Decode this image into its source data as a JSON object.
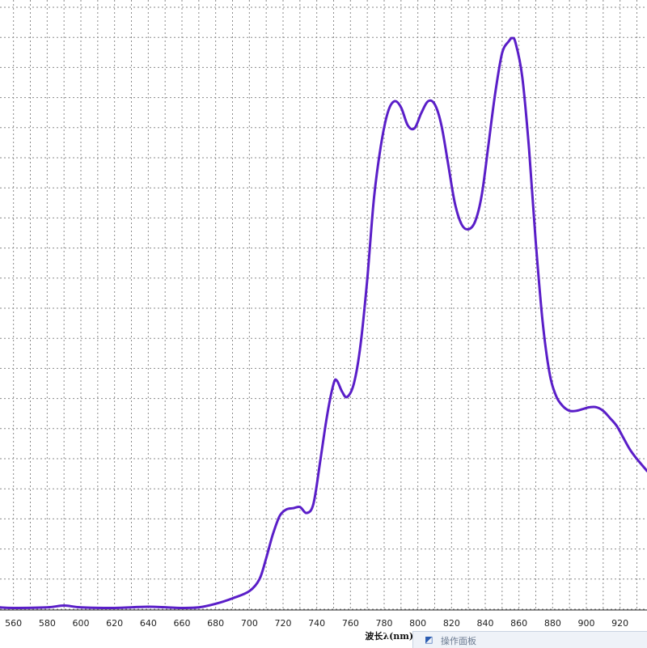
{
  "chart_data": {
    "type": "line",
    "title": "",
    "xlabel": "波长λ(nm)",
    "ylabel": "",
    "xlim": [
      552,
      936
    ],
    "ylim": [
      0,
      100
    ],
    "grid": true,
    "x_ticks": [
      560,
      580,
      600,
      620,
      640,
      660,
      680,
      700,
      720,
      740,
      760,
      780,
      800,
      820,
      840,
      860,
      880,
      900,
      920
    ],
    "series": [
      {
        "color": "#5a1ec8",
        "x": [
          552,
          560,
          580,
          590,
          600,
          620,
          640,
          660,
          670,
          680,
          690,
          700,
          706,
          710,
          714,
          718,
          722,
          726,
          730,
          734,
          738,
          742,
          746,
          750,
          752,
          755,
          758,
          762,
          766,
          770,
          774,
          778,
          782,
          786,
          790,
          794,
          798,
          802,
          806,
          810,
          814,
          818,
          822,
          826,
          830,
          834,
          838,
          842,
          846,
          850,
          854,
          856,
          858,
          862,
          866,
          870,
          874,
          878,
          882,
          886,
          890,
          894,
          898,
          902,
          906,
          910,
          914,
          918,
          922,
          926,
          930,
          936
        ],
        "y": [
          0.3,
          0.2,
          0.3,
          0.6,
          0.3,
          0.2,
          0.4,
          0.2,
          0.3,
          0.9,
          1.8,
          3.0,
          5.0,
          8.5,
          12.5,
          15.5,
          16.6,
          16.8,
          17.0,
          16.0,
          17.5,
          24.5,
          32.0,
          37.5,
          38.0,
          36.2,
          35.3,
          37.5,
          44.0,
          55.0,
          68.5,
          77.0,
          82.5,
          84.5,
          83.5,
          80.5,
          80.0,
          82.5,
          84.5,
          84.0,
          80.5,
          74.0,
          67.5,
          64.0,
          63.2,
          64.5,
          69.0,
          77.5,
          86.0,
          92.5,
          94.5,
          95.0,
          94.2,
          88.5,
          76.5,
          61.0,
          48.0,
          39.5,
          35.5,
          33.8,
          33.0,
          33.0,
          33.3,
          33.6,
          33.6,
          33.0,
          31.8,
          30.5,
          28.5,
          26.5,
          25.0,
          23.0
        ]
      }
    ]
  },
  "taskbar": {
    "icon": "app-icon",
    "label": "操作面板"
  }
}
